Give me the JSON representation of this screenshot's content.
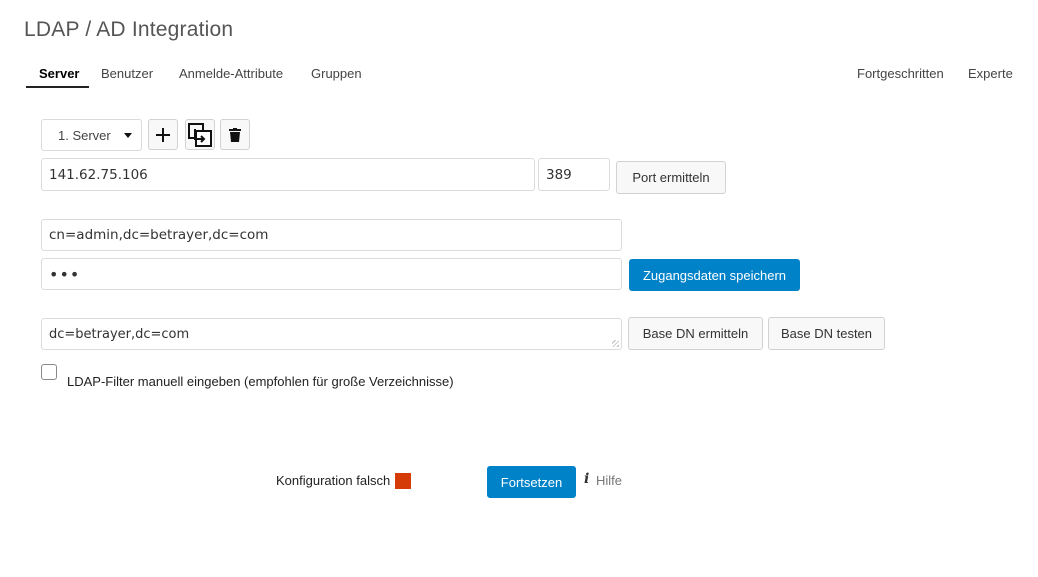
{
  "page": {
    "title": "LDAP / AD Integration"
  },
  "tabs_left": [
    {
      "label": "Server",
      "active": true
    },
    {
      "label": "Benutzer"
    },
    {
      "label": "Anmelde-Attribute"
    },
    {
      "label": "Gruppen"
    }
  ],
  "tabs_right": [
    {
      "label": "Fortgeschritten"
    },
    {
      "label": "Experte"
    }
  ],
  "server": {
    "selected": "1. Server",
    "host_value": "141.62.75.106",
    "port_value": "389",
    "port_button": "Port ermitteln"
  },
  "toolbar_icons": [
    "plus-icon",
    "copy-config-icon",
    "trash-icon"
  ],
  "credentials": {
    "user_dn_value": "cn=admin,dc=betrayer,dc=com",
    "password_value": "•••",
    "save_button": "Zugangsdaten speichern"
  },
  "base_dn": {
    "value": "dc=betrayer,dc=com",
    "detect_button": "Base DN ermitteln",
    "test_button": "Base DN testen"
  },
  "ldap_filter": {
    "checked": false,
    "label": "LDAP-Filter manuell eingeben (empfohlen für große Verzeichnisse)"
  },
  "footer": {
    "status_text": "Konfiguration falsch",
    "status_color": "#d43b07",
    "continue_button": "Fortsetzen",
    "help_icon": "i",
    "help_label": "Hilfe"
  },
  "colors": {
    "primary": "#0082c9"
  }
}
